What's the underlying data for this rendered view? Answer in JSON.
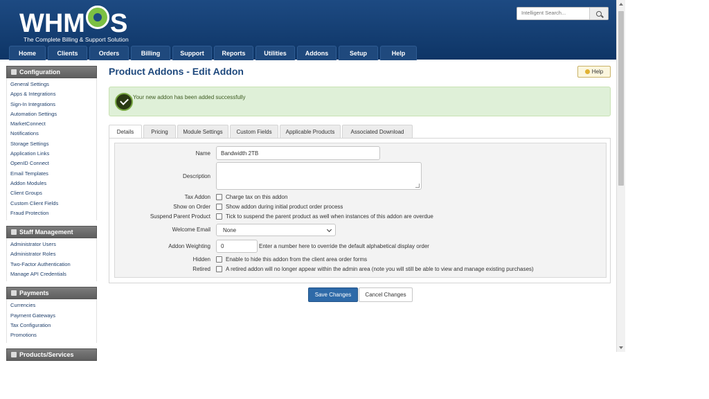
{
  "logo": {
    "word_left": "WHM",
    "word_right": "S",
    "tagline": "The Complete Billing & Support Solution"
  },
  "search": {
    "placeholder": "Intelligent Search..."
  },
  "nav": [
    "Home",
    "Clients",
    "Orders",
    "Billing",
    "Support",
    "Reports",
    "Utilities",
    "Addons",
    "Setup",
    "Help"
  ],
  "sidebar": {
    "configuration": {
      "title": "Configuration",
      "items": [
        "General Settings",
        "Apps & Integrations",
        "Sign-In Integrations",
        "Automation Settings",
        "MarketConnect",
        "Notifications",
        "Storage Settings",
        "Application Links",
        "OpenID Connect",
        "Email Templates",
        "Addon Modules",
        "Client Groups",
        "Custom Client Fields",
        "Fraud Protection"
      ]
    },
    "staff": {
      "title": "Staff Management",
      "items": [
        "Administrator Users",
        "Administrator Roles",
        "Two-Factor Authentication",
        "Manage API Credentials"
      ]
    },
    "payments": {
      "title": "Payments",
      "items": [
        "Currencies",
        "Payment Gateways",
        "Tax Configuration",
        "Promotions"
      ]
    },
    "products": {
      "title": "Products/Services"
    }
  },
  "page": {
    "title": "Product Addons - Edit Addon",
    "help": "Help"
  },
  "alert": {
    "message": "Your new addon has been added successfully"
  },
  "tabs": [
    "Details",
    "Pricing",
    "Module Settings",
    "Custom Fields",
    "Applicable Products",
    "Associated Download"
  ],
  "form": {
    "name": {
      "label": "Name",
      "value": "Bandwidth 2TB"
    },
    "description": {
      "label": "Description",
      "value": ""
    },
    "tax_addon": {
      "label": "Tax Addon",
      "text": "Charge tax on this addon"
    },
    "show_on_order": {
      "label": "Show on Order",
      "text": "Show addon during initial product order process"
    },
    "suspend_parent": {
      "label": "Suspend Parent Product",
      "text": "Tick to suspend the parent product as well when instances of this addon are overdue"
    },
    "welcome_email": {
      "label": "Welcome Email",
      "value": "None"
    },
    "weighting": {
      "label": "Addon Weighting",
      "value": "0",
      "text": "Enter a number here to override the default alphabetical display order"
    },
    "hidden": {
      "label": "Hidden",
      "text": "Enable to hide this addon from the client area order forms"
    },
    "retired": {
      "label": "Retired",
      "text": "A retired addon will no longer appear within the admin area (note you will still be able to view and manage existing purchases)"
    }
  },
  "buttons": {
    "save": "Save Changes",
    "cancel": "Cancel Changes"
  }
}
